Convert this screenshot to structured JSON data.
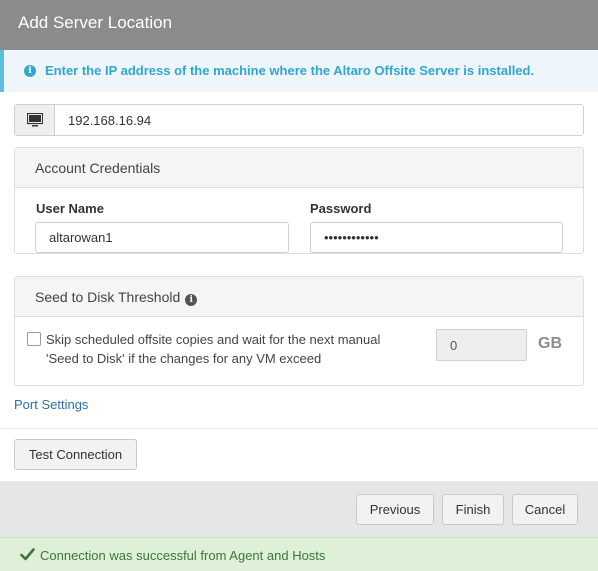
{
  "dialog": {
    "title": "Add Server Location"
  },
  "info": {
    "icon": "info-circle-icon",
    "message": "Enter the IP address of the machine where the Altaro Offsite Server is installed."
  },
  "server": {
    "icon": "monitor-icon",
    "ip_value": "192.168.16.94"
  },
  "credentials": {
    "heading": "Account Credentials",
    "username_label": "User Name",
    "username_value": "altarowan1",
    "password_label": "Password",
    "password_value": "••••••••••••"
  },
  "seed": {
    "heading": "Seed to Disk Threshold",
    "heading_icon": "info-circle-icon",
    "checkbox_checked": false,
    "checkbox_text": "Skip scheduled offsite copies and wait for the next manual 'Seed to Disk' if the changes for any VM exceed",
    "gb_value": "0",
    "gb_unit": "GB"
  },
  "links": {
    "port_settings": "Port Settings"
  },
  "buttons": {
    "test_connection": "Test Connection",
    "previous": "Previous",
    "finish": "Finish",
    "cancel": "Cancel"
  },
  "status": {
    "icon": "check-icon",
    "message": "Connection was successful from Agent and Hosts",
    "color": "#3c763d"
  },
  "colors": {
    "title_bar": "#8a8b8d",
    "info_accent": "#31a7cf",
    "link": "#2f6fa7",
    "success_bg": "#dff0d8"
  }
}
